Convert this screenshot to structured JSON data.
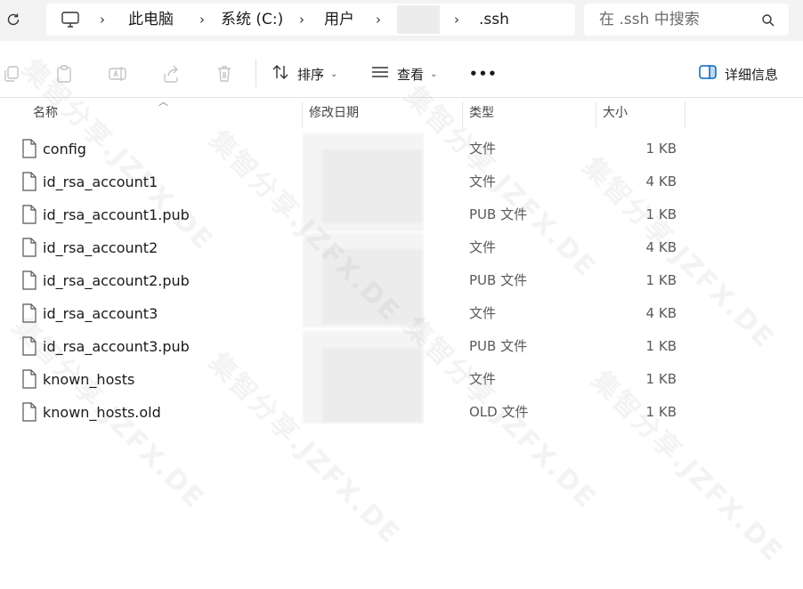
{
  "address_bar": {
    "breadcrumbs": [
      "此电脑",
      "系统 (C:)",
      "用户",
      ".ssh"
    ],
    "refresh_icon": "refresh-icon",
    "pc_icon": "monitor-icon"
  },
  "search": {
    "placeholder": "在 .ssh 中搜索",
    "icon": "search-icon"
  },
  "toolbar": {
    "sort_label": "排序",
    "view_label": "查看",
    "more_label": "•••",
    "details_label": "详细信息",
    "icons": [
      "copy-icon",
      "paste-icon",
      "rename-icon",
      "share-icon",
      "delete-icon",
      "sort-icon",
      "view-icon",
      "details-pane-icon"
    ]
  },
  "columns": {
    "name": "名称",
    "modified": "修改日期",
    "type": "类型",
    "size": "大小"
  },
  "files": [
    {
      "name": "config",
      "type": "文件",
      "size": "1 KB"
    },
    {
      "name": "id_rsa_account1",
      "type": "文件",
      "size": "4 KB"
    },
    {
      "name": "id_rsa_account1.pub",
      "type": "PUB 文件",
      "size": "1 KB"
    },
    {
      "name": "id_rsa_account2",
      "type": "文件",
      "size": "4 KB"
    },
    {
      "name": "id_rsa_account2.pub",
      "type": "PUB 文件",
      "size": "1 KB"
    },
    {
      "name": "id_rsa_account3",
      "type": "文件",
      "size": "4 KB"
    },
    {
      "name": "id_rsa_account3.pub",
      "type": "PUB 文件",
      "size": "1 KB"
    },
    {
      "name": "known_hosts",
      "type": "文件",
      "size": "1 KB"
    },
    {
      "name": "known_hosts.old",
      "type": "OLD 文件",
      "size": "1 KB"
    }
  ],
  "watermark": "集智分享.JZFX.DE",
  "colors": {
    "addr_bg": "#f3f3f3",
    "accent": "#0067c0"
  }
}
